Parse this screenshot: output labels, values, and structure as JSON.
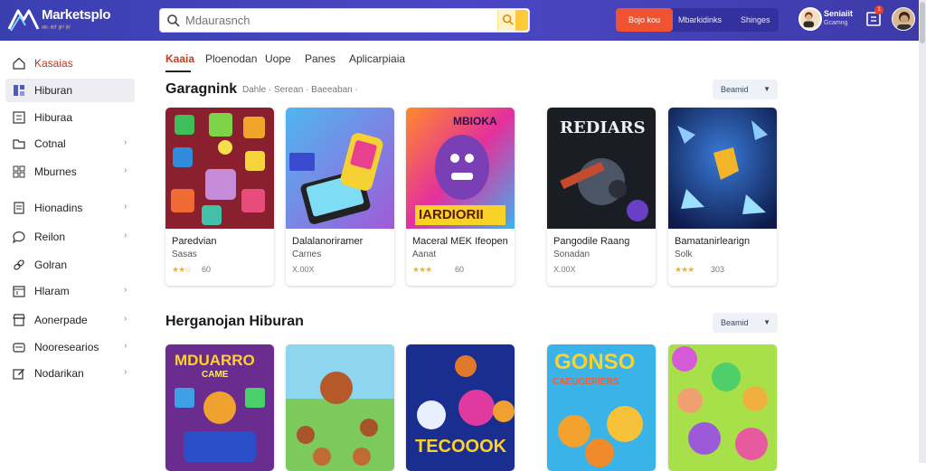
{
  "header": {
    "app_title": "Marketsplo",
    "app_subtitle": "ᵃᵇᶜ ᵈᵉᶠ ᵍʰⁱ ʲᵏˡ",
    "search": {
      "placeholder": "Mdaurasnch",
      "value": ""
    },
    "primary_button": "Bojo kou",
    "links": [
      "Mbarkidinks",
      "Shinges"
    ],
    "user": {
      "name": "Seniaiit",
      "subtitle": "Gcamng"
    },
    "notification_count": "1"
  },
  "sidebar": {
    "items": [
      {
        "label": "Kasaias",
        "icon": "home-icon",
        "chevron": false,
        "active": false
      },
      {
        "label": "Hiburan",
        "icon": "grid-icon",
        "chevron": false,
        "active": true
      },
      {
        "label": "Hiburaa",
        "icon": "list-icon",
        "chevron": false,
        "active": false
      },
      {
        "label": "Cotnal",
        "icon": "folder-icon",
        "chevron": true,
        "active": false
      },
      {
        "label": "Mburnes",
        "icon": "apps-icon",
        "chevron": true,
        "active": false
      },
      {
        "label": "Hionadins",
        "icon": "document-icon",
        "chevron": true,
        "active": false
      },
      {
        "label": "Reilon",
        "icon": "chat-icon",
        "chevron": true,
        "active": false
      },
      {
        "label": "Golran",
        "icon": "link-icon",
        "chevron": false,
        "active": false
      },
      {
        "label": "Hlaram",
        "icon": "calendar-icon",
        "chevron": true,
        "active": false
      },
      {
        "label": "Aonerpade",
        "icon": "store-icon",
        "chevron": true,
        "active": false
      },
      {
        "label": "Nooresearios",
        "icon": "inbox-icon",
        "chevron": true,
        "active": false
      },
      {
        "label": "Nodarikan",
        "icon": "edit-icon",
        "chevron": true,
        "active": false
      }
    ]
  },
  "tabs": [
    {
      "label": "Kaaia",
      "active": true
    },
    {
      "label": "Ploenodan",
      "active": false
    },
    {
      "label": "Uope",
      "active": false
    },
    {
      "label": "Panes",
      "active": false
    },
    {
      "label": "Aplicarpiaia",
      "active": false
    }
  ],
  "section1": {
    "title": "Garagnink",
    "meta": "Dahle · Serean · Baeeaban ·",
    "sort_label": "Beamid",
    "cards": [
      {
        "title": "Paredvian",
        "subtitle": "Sasas",
        "stars": "★★☆",
        "rating": "60",
        "art": "cubes"
      },
      {
        "title": "Dalalanoriramer",
        "subtitle": "Carnes",
        "stars": "",
        "rating": "X.00X",
        "art": "phone"
      },
      {
        "title": "Maceral MEK Ifeopen",
        "subtitle": "Aanat",
        "stars": "★★★",
        "rating": "60",
        "art": "mbioka",
        "badge": "MBIOKA",
        "banner": "IARDIORII"
      },
      {
        "title": "Pangodile Raang",
        "subtitle": "Sonadan",
        "stars": "",
        "rating": "X.00X",
        "art": "rediars",
        "badge": "REDIARS"
      },
      {
        "title": "Bamatanirlearign",
        "subtitle": "Solk",
        "stars": "★★★",
        "rating": "303",
        "art": "space"
      }
    ]
  },
  "section2": {
    "title": "Herganojan Hiburan",
    "sort_label": "Beamid",
    "cards": [
      {
        "art": "puzzle",
        "badge": "MDUARRO",
        "badge2": "CAME"
      },
      {
        "art": "forest"
      },
      {
        "art": "monsters",
        "badge": "TECOOOK"
      },
      {
        "art": "gonso",
        "badge": "GONSO",
        "badge2": "CAEUGERIERS"
      },
      {
        "art": "balloons"
      }
    ]
  },
  "colors": {
    "header_bg": "#4b47c4",
    "accent_orange": "#ef5331",
    "accent_yellow": "#ffc93a",
    "tab_active": "#c63a1c"
  }
}
